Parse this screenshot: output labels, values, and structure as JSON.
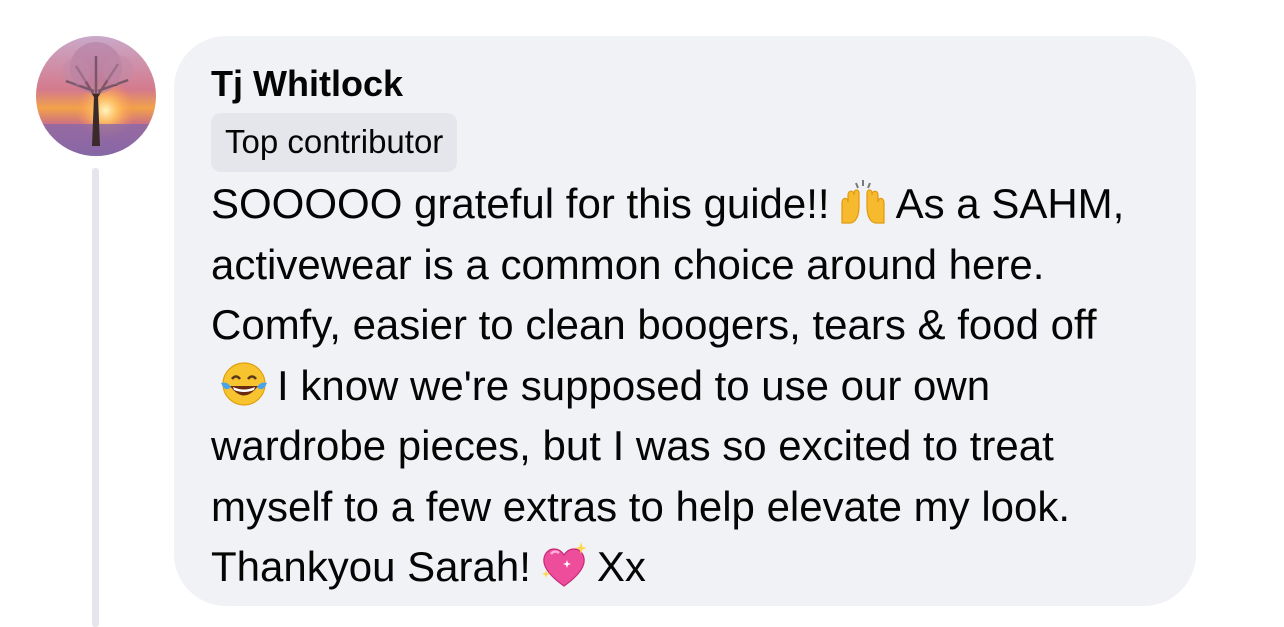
{
  "comment": {
    "author": "Tj Whitlock",
    "badge": "Top contributor",
    "text_1": "SOOOOO grateful for this guide!!",
    "emoji_1": "raising-hands-emoji",
    "text_2": "As a SAHM, activewear is a common choice around here. Comfy, easier to clean boogers, tears & food off",
    "emoji_2": "tears-of-joy-emoji",
    "text_3": "I know we're supposed to use our own wardrobe pieces, but I was so excited to treat myself to a few extras to help elevate my look. Thankyou Sarah!",
    "emoji_3": "sparkling-heart-emoji",
    "text_4": "Xx"
  },
  "colors": {
    "bubble_bg": "#f0f2f5",
    "badge_bg": "#e4e6eb",
    "text": "#050505",
    "thread_line": "#e4e6eb"
  }
}
